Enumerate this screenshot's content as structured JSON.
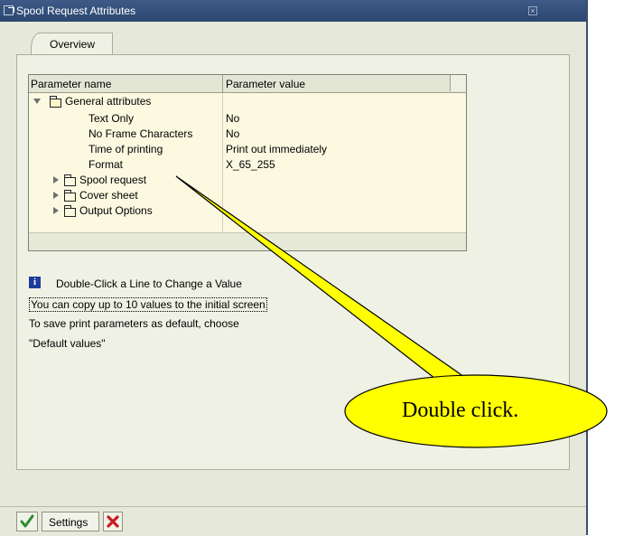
{
  "window": {
    "title": "Spool Request Attributes"
  },
  "tabs": [
    {
      "label": "Overview"
    }
  ],
  "grid": {
    "columns": [
      "Parameter name",
      "Parameter value"
    ],
    "rows": [
      {
        "name": "General attributes",
        "value": "",
        "expanded": true
      },
      {
        "name": "Text Only",
        "value": "No"
      },
      {
        "name": "No Frame Characters",
        "value": "No"
      },
      {
        "name": "Time of printing",
        "value": "Print out immediately"
      },
      {
        "name": "Format",
        "value": "X_65_255"
      },
      {
        "name": "Spool request",
        "value": "",
        "expanded": false
      },
      {
        "name": "Cover sheet",
        "value": "",
        "expanded": false
      },
      {
        "name": "Output Options",
        "value": "",
        "expanded": false
      }
    ]
  },
  "messages": {
    "title": "Double-Click a Line to Change a Value",
    "line1": "You can copy up to 10 values to the initial screen",
    "line2": "To save print parameters as default, choose",
    "line3": "\"Default values\""
  },
  "footer": {
    "settings_label": "Settings"
  },
  "callout": {
    "text": "Double click.",
    "color": "#ffff00"
  },
  "colors": {
    "titlebar": "#2b4770",
    "dialog_bg": "#e6e9d9",
    "grid_bg": "#fcf9e1",
    "info_icon": "#1d3c9a",
    "cancel_icon": "#c81c1c",
    "ok_icon": "#2e8b2e"
  },
  "icons": [
    "window-menu-icon",
    "close-icon",
    "info-icon",
    "ok-check-icon",
    "cancel-x-icon",
    "folder-icon",
    "expand-triangle-icon",
    "collapse-triangle-icon"
  ]
}
